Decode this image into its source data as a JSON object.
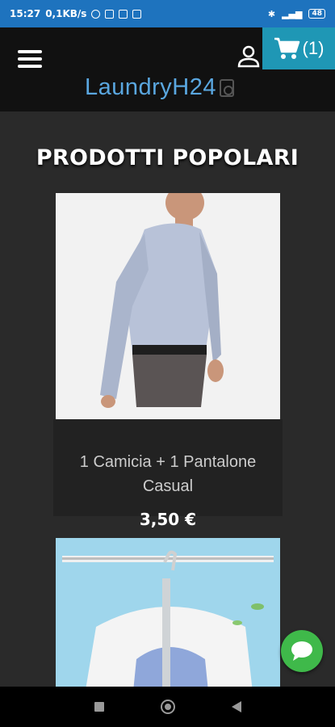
{
  "status_bar": {
    "time": "15:27",
    "speed": "0,1KB/s",
    "battery": "48"
  },
  "header": {
    "cart_count": "(1)",
    "logo_text": "LaundryH24"
  },
  "section": {
    "title": "PRODOTTI POPOLARI"
  },
  "products": [
    {
      "name_line1": "1 Camicia + 1 Pantalone",
      "name_line2": "Casual",
      "price": "3,50 €",
      "image": "shirt-man-photo"
    },
    {
      "image": "shirts-on-hanger-photo"
    }
  ],
  "colors": {
    "status_bar": "#1e73be",
    "cart": "#1f97b5",
    "logo": "#5aa7e0",
    "chat": "#3fb94a"
  }
}
